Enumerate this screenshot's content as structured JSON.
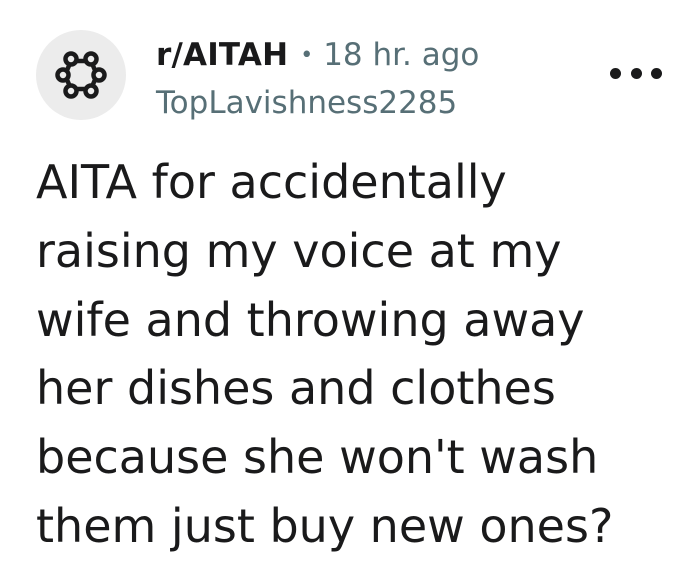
{
  "post": {
    "subreddit": "r/AITAH",
    "separator": "•",
    "age": "18 hr. ago",
    "author": "TopLavishness2285",
    "title": "AITA for accidentally raising my voice at my wife and throwing away her dishes and clothes because she won't wash them just buy new ones?",
    "title_lines": [
      "AITA for accidentally",
      "raising my voice at my",
      "wife and throwing away",
      "her dishes and clothes",
      "because she won't wash",
      "them just buy new ones?"
    ]
  },
  "icons": {
    "avatar": "subreddit-snoo-icon",
    "more": "more-options-icon"
  },
  "colors": {
    "text_primary": "#1a1a1b",
    "text_secondary": "#576f76",
    "avatar_bg": "#ececec",
    "background": "#ffffff"
  }
}
